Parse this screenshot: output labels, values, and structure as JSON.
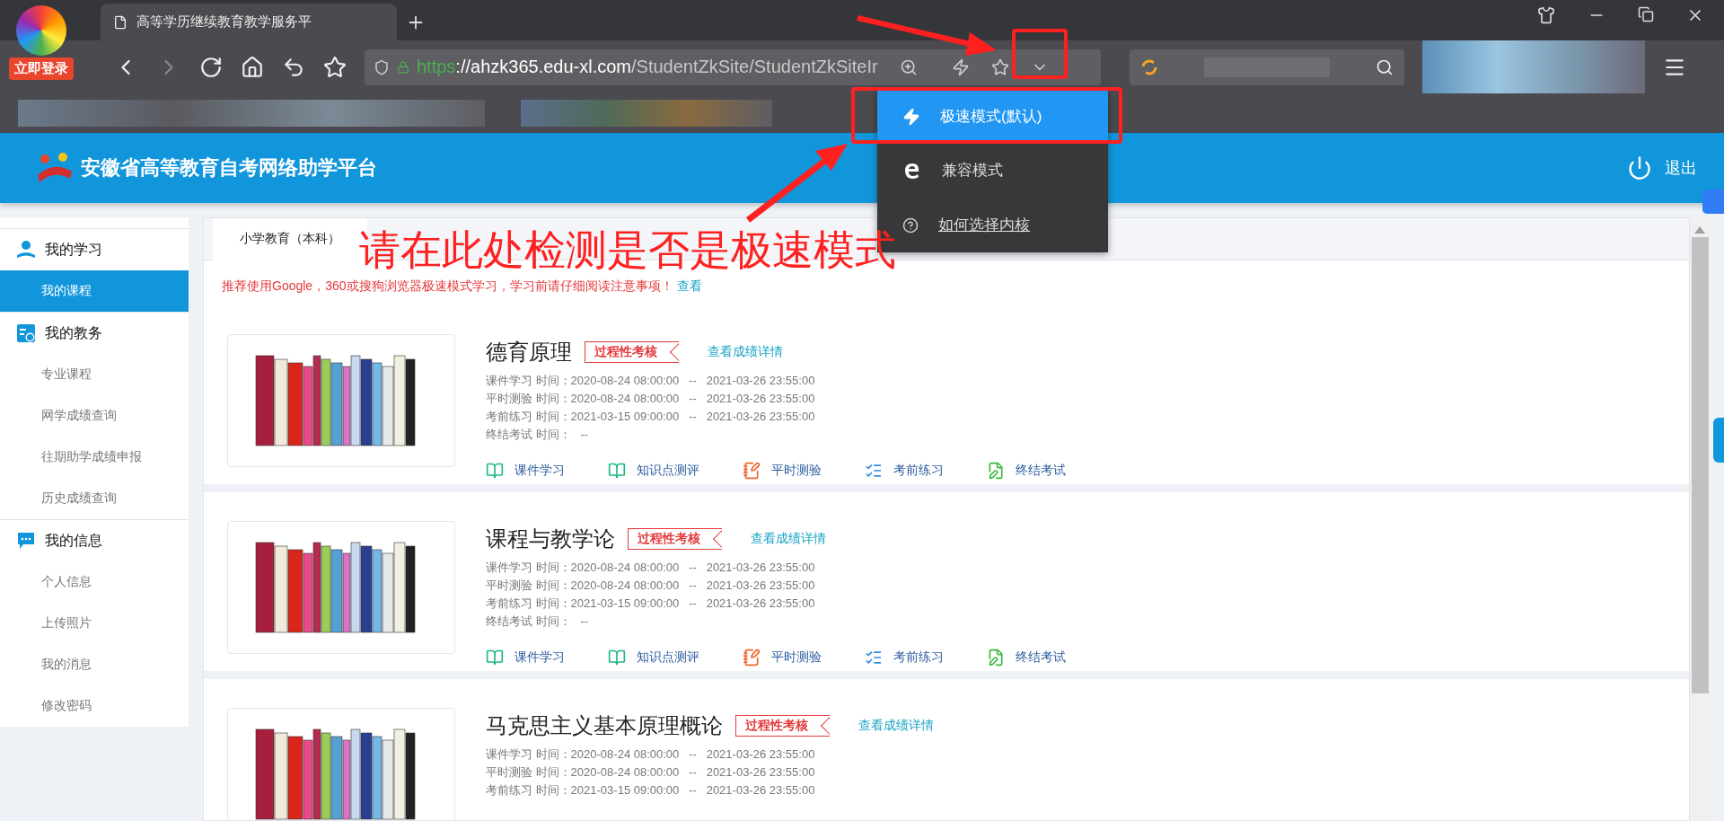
{
  "browser": {
    "login_badge": "立即登录",
    "tabs": [
      {
        "title": "高等学历继续教育教学服务平",
        "selected": true
      }
    ],
    "url": {
      "scheme": "https",
      "host": "://ahzk365.edu-xl.com",
      "path": "/StudentZkSite/StudentZkSiteIr"
    }
  },
  "kernel_menu": {
    "items": [
      {
        "kind": "fast",
        "label": "极速模式(默认)",
        "selected": true
      },
      {
        "kind": "compat",
        "label": "兼容模式",
        "selected": false
      },
      {
        "kind": "help",
        "label": "如何选择内核",
        "selected": false
      }
    ]
  },
  "annotation": {
    "text": "请在此处检测是否是极速模式"
  },
  "site": {
    "title": "安徽省高等教育自考网络助学平台",
    "logout": "退出"
  },
  "sidebar": {
    "groups": [
      {
        "kind": "study",
        "label": "我的学习",
        "items": [
          {
            "label": "我的课程",
            "selected": true
          }
        ]
      },
      {
        "kind": "affairs",
        "label": "我的教务",
        "items": [
          {
            "label": "专业课程",
            "selected": false
          },
          {
            "label": "网学成绩查询",
            "selected": false
          },
          {
            "label": "往期助学成绩申报",
            "selected": false
          },
          {
            "label": "历史成绩查询",
            "selected": false
          }
        ]
      },
      {
        "kind": "info",
        "label": "我的信息",
        "items": [
          {
            "label": "个人信息",
            "selected": false
          },
          {
            "label": "上传照片",
            "selected": false
          },
          {
            "label": "我的消息",
            "selected": false
          },
          {
            "label": "修改密码",
            "selected": false
          }
        ]
      }
    ]
  },
  "content": {
    "tabs": [
      {
        "label": "小学教育（本科）",
        "selected": true
      }
    ],
    "notice": "推荐使用Google，360或搜狗浏览器极速模式学习，学习前请仔细阅读注意事项！",
    "notice_link": "查看",
    "courses": [
      {
        "title": "德育原理",
        "badge": "过程性考核",
        "details_link": "查看成绩详情",
        "schedule": [
          "课件学习 时间：2020-08-24 08:00:00   --   2021-03-26 23:55:00",
          "平时测验 时间：2020-08-24 08:00:00   --   2021-03-26 23:55:00",
          "考前练习 时间：2021-03-15 09:00:00   --   2021-03-26 23:55:00",
          "终结考试 时间：   --"
        ],
        "actions": [
          {
            "kind": "courseware",
            "label": "课件学习"
          },
          {
            "kind": "knowledge",
            "label": "知识点测评"
          },
          {
            "kind": "quiz",
            "label": "平时测验"
          },
          {
            "kind": "practice",
            "label": "考前练习"
          },
          {
            "kind": "final",
            "label": "终结考试"
          }
        ]
      },
      {
        "title": "课程与教学论",
        "badge": "过程性考核",
        "details_link": "查看成绩详情",
        "schedule": [
          "课件学习 时间：2020-08-24 08:00:00   --   2021-03-26 23:55:00",
          "平时测验 时间：2020-08-24 08:00:00   --   2021-03-26 23:55:00",
          "考前练习 时间：2021-03-15 09:00:00   --   2021-03-26 23:55:00",
          "终结考试 时间：   --"
        ],
        "actions": [
          {
            "kind": "courseware",
            "label": "课件学习"
          },
          {
            "kind": "knowledge",
            "label": "知识点测评"
          },
          {
            "kind": "quiz",
            "label": "平时测验"
          },
          {
            "kind": "practice",
            "label": "考前练习"
          },
          {
            "kind": "final",
            "label": "终结考试"
          }
        ]
      },
      {
        "title": "马克思主义基本原理概论",
        "badge": "过程性考核",
        "details_link": "查看成绩详情",
        "schedule": [
          "课件学习 时间：2020-08-24 08:00:00   --   2021-03-26 23:55:00",
          "平时测验 时间：2020-08-24 08:00:00   --   2021-03-26 23:55:00",
          "考前练习 时间：2021-03-15 09:00:00   --   2021-03-26 23:55:00"
        ]
      }
    ]
  }
}
